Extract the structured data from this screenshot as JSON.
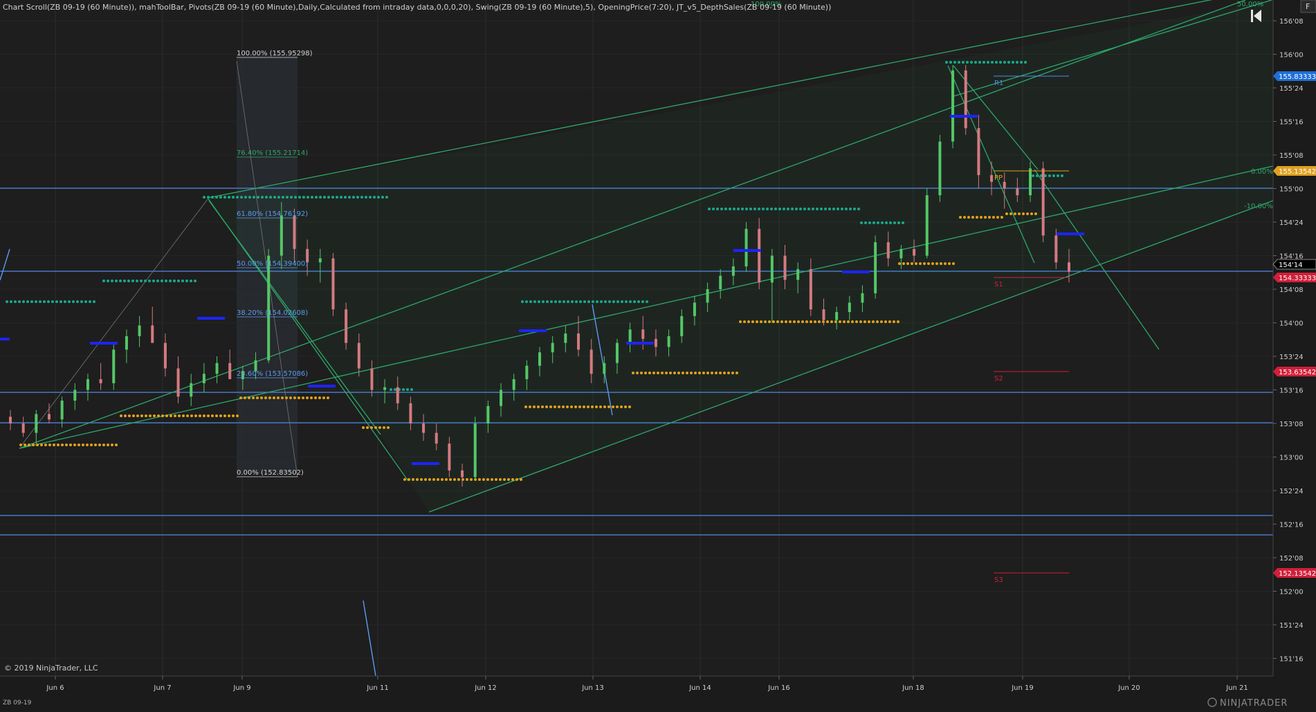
{
  "header": {
    "indicators": "Chart Scroll(ZB 09-19 (60 Minute)), mahToolBar, Pivots(ZB 09-19 (60 Minute),Daily,Calculated from intraday data,0,0,0,20), Swing(ZB 09-19 (60 Minute),5), OpeningPrice(7:20), JT_v5_DepthSales(ZB 09-19 (60 Minute))"
  },
  "footer": {
    "copyright": "© 2019 NinjaTrader, LLC",
    "instrument": "ZB 09-19",
    "brand": "NINJATRADER"
  },
  "toolbar": {
    "f_label": "F"
  },
  "chart_data": {
    "type": "candlestick",
    "instrument": "ZB 09-19",
    "timeframe": "60 Minute",
    "x_labels": [
      "Jun 6",
      "Jun 7",
      "Jun 9",
      "Jun 11",
      "Jun 12",
      "Jun 13",
      "Jun 14",
      "Jun 16",
      "Jun 18",
      "Jun 19",
      "Jun 20",
      "Jun 21"
    ],
    "y_ticks": [
      "156'08",
      "156'00",
      "155'24",
      "155'16",
      "155'08",
      "155'00",
      "154'24",
      "154'16",
      "154'08",
      "154'00",
      "153'24",
      "153'16",
      "153'08",
      "153'00",
      "152'24",
      "152'16",
      "152'08",
      "152'00",
      "151'24",
      "151'16"
    ],
    "ylim": [
      151.4,
      156.4
    ],
    "last_price_label": "154'14",
    "price_flags": [
      {
        "value": "155.83333",
        "color": "#1e6fd6"
      },
      {
        "value": "155.13542",
        "color": "#e0a020"
      },
      {
        "value": "154.33333",
        "color": "#d11f3a"
      },
      {
        "value": "153.63542",
        "color": "#d11f3a"
      },
      {
        "value": "152.13542",
        "color": "#d11f3a"
      }
    ],
    "pivot_labels": [
      "R1",
      "PP",
      "S1",
      "S2",
      "S3"
    ],
    "fib_levels": [
      "100.00% (155.95298)",
      "76.40% (155.21714)",
      "61.80% (154.76192)",
      "50.00% (154.39400)",
      "38.20% (154.02608)",
      "23.60% (153.57086)",
      "0.00% (152.83502)"
    ],
    "channel_labels": [
      "100.00%",
      "50.00%",
      "0.00%",
      "-10.00%"
    ],
    "candles": [
      [
        153.3,
        153.35,
        153.2,
        153.25
      ],
      [
        153.25,
        153.3,
        153.15,
        153.18
      ],
      [
        153.18,
        153.35,
        153.1,
        153.32
      ],
      [
        153.32,
        153.4,
        153.25,
        153.28
      ],
      [
        153.28,
        153.45,
        153.22,
        153.42
      ],
      [
        153.42,
        153.55,
        153.35,
        153.5
      ],
      [
        153.5,
        153.62,
        153.42,
        153.58
      ],
      [
        153.58,
        153.7,
        153.5,
        153.55
      ],
      [
        153.55,
        153.85,
        153.5,
        153.8
      ],
      [
        153.8,
        153.95,
        153.7,
        153.9
      ],
      [
        153.9,
        154.05,
        153.82,
        153.98
      ],
      [
        153.98,
        154.12,
        153.9,
        153.85
      ],
      [
        153.85,
        153.92,
        153.6,
        153.66
      ],
      [
        153.66,
        153.75,
        153.4,
        153.45
      ],
      [
        153.45,
        153.62,
        153.38,
        153.55
      ],
      [
        153.55,
        153.7,
        153.48,
        153.62
      ],
      [
        153.62,
        153.75,
        153.55,
        153.7
      ],
      [
        153.7,
        153.8,
        153.6,
        153.58
      ],
      [
        153.58,
        153.68,
        153.5,
        153.64
      ],
      [
        153.64,
        153.78,
        153.58,
        153.72
      ],
      [
        153.72,
        154.55,
        153.7,
        154.5
      ],
      [
        154.5,
        154.9,
        154.4,
        154.8
      ],
      [
        154.8,
        154.85,
        154.45,
        154.55
      ],
      [
        154.55,
        154.62,
        154.35,
        154.45
      ],
      [
        154.45,
        154.55,
        154.3,
        154.48
      ],
      [
        154.48,
        154.52,
        154.05,
        154.1
      ],
      [
        154.1,
        154.15,
        153.8,
        153.85
      ],
      [
        153.85,
        153.92,
        153.6,
        153.66
      ],
      [
        153.66,
        153.72,
        153.45,
        153.5
      ],
      [
        153.5,
        153.58,
        153.4,
        153.52
      ],
      [
        153.52,
        153.6,
        153.35,
        153.4
      ],
      [
        153.4,
        153.45,
        153.2,
        153.25
      ],
      [
        153.25,
        153.32,
        153.12,
        153.18
      ],
      [
        153.18,
        153.25,
        153.05,
        153.1
      ],
      [
        153.1,
        153.15,
        152.85,
        152.9
      ],
      [
        152.9,
        152.95,
        152.78,
        152.85
      ],
      [
        152.85,
        153.3,
        152.83,
        153.25
      ],
      [
        153.25,
        153.42,
        153.18,
        153.38
      ],
      [
        153.38,
        153.55,
        153.3,
        153.5
      ],
      [
        153.5,
        153.62,
        153.42,
        153.58
      ],
      [
        153.58,
        153.72,
        153.5,
        153.68
      ],
      [
        153.68,
        153.82,
        153.6,
        153.78
      ],
      [
        153.78,
        153.9,
        153.7,
        153.85
      ],
      [
        153.85,
        153.98,
        153.78,
        153.92
      ],
      [
        153.92,
        154.05,
        153.75,
        153.8
      ],
      [
        153.8,
        153.88,
        153.55,
        153.62
      ],
      [
        153.62,
        153.75,
        153.55,
        153.7
      ],
      [
        153.7,
        153.88,
        153.62,
        153.85
      ],
      [
        153.85,
        154.0,
        153.78,
        153.95
      ],
      [
        153.95,
        154.05,
        153.8,
        153.88
      ],
      [
        153.88,
        153.95,
        153.75,
        153.82
      ],
      [
        153.82,
        153.95,
        153.75,
        153.9
      ],
      [
        153.9,
        154.1,
        153.85,
        154.05
      ],
      [
        154.05,
        154.2,
        153.98,
        154.15
      ],
      [
        154.15,
        154.3,
        154.08,
        154.25
      ],
      [
        154.25,
        154.4,
        154.18,
        154.35
      ],
      [
        154.35,
        154.48,
        154.28,
        154.42
      ],
      [
        154.42,
        154.75,
        154.38,
        154.7
      ],
      [
        154.7,
        154.78,
        154.25,
        154.3
      ],
      [
        154.3,
        154.55,
        154.0,
        154.5
      ],
      [
        154.5,
        154.58,
        154.25,
        154.32
      ],
      [
        154.32,
        154.45,
        154.22,
        154.4
      ],
      [
        154.4,
        154.48,
        154.05,
        154.1
      ],
      [
        154.1,
        154.18,
        153.98,
        154.02
      ],
      [
        154.02,
        154.12,
        153.95,
        154.08
      ],
      [
        154.08,
        154.2,
        154.02,
        154.15
      ],
      [
        154.15,
        154.28,
        154.08,
        154.22
      ],
      [
        154.22,
        154.65,
        154.18,
        154.6
      ],
      [
        154.6,
        154.68,
        154.42,
        154.48
      ],
      [
        154.48,
        154.58,
        154.4,
        154.55
      ],
      [
        154.55,
        154.62,
        154.45,
        154.5
      ],
      [
        154.5,
        155.0,
        154.48,
        154.95
      ],
      [
        154.95,
        155.4,
        154.9,
        155.35
      ],
      [
        155.35,
        155.92,
        155.3,
        155.88
      ],
      [
        155.88,
        155.92,
        155.4,
        155.45
      ],
      [
        155.45,
        155.55,
        155.0,
        155.1
      ],
      [
        155.1,
        155.2,
        154.95,
        155.05
      ],
      [
        155.05,
        155.12,
        154.85,
        155.0
      ],
      [
        155.0,
        155.08,
        154.9,
        154.95
      ],
      [
        154.95,
        155.2,
        154.9,
        155.15
      ],
      [
        155.15,
        155.2,
        154.6,
        154.65
      ],
      [
        154.65,
        154.7,
        154.4,
        154.45
      ],
      [
        154.45,
        154.55,
        154.3,
        154.38
      ]
    ]
  }
}
